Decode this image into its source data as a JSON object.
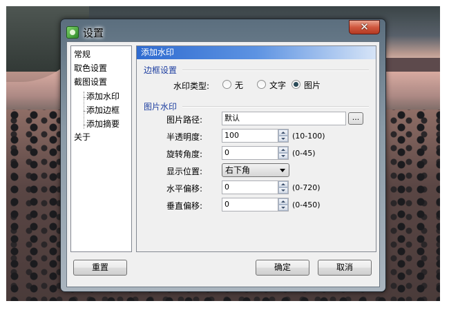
{
  "dialog": {
    "title": "设置",
    "close_glyph": "✕"
  },
  "nav": {
    "items": [
      {
        "label": "常规",
        "level": 0
      },
      {
        "label": "取色设置",
        "level": 0
      },
      {
        "label": "截图设置",
        "level": 0
      },
      {
        "label": "添加水印",
        "level": 1
      },
      {
        "label": "添加边框",
        "level": 1
      },
      {
        "label": "添加摘要",
        "level": 1
      },
      {
        "label": "关于",
        "level": 0
      }
    ]
  },
  "panel": {
    "header": "添加水印",
    "border_section": {
      "title": "边框设置",
      "type_label": "水印类型:",
      "options": [
        {
          "label": "无",
          "selected": false
        },
        {
          "label": "文字",
          "selected": false
        },
        {
          "label": "图片",
          "selected": true
        }
      ]
    },
    "image_section": {
      "title": "图片水印",
      "path_label": "图片路径:",
      "path_value": "默认",
      "browse_label": "...",
      "opacity_label": "半透明度:",
      "opacity_value": "100",
      "opacity_range": "(10-100)",
      "rotation_label": "旋转角度:",
      "rotation_value": "0",
      "rotation_range": "(0-45)",
      "position_label": "显示位置:",
      "position_value": "右下角",
      "hoffset_label": "水平偏移:",
      "hoffset_value": "0",
      "hoffset_range": "(0-720)",
      "voffset_label": "垂直偏移:",
      "voffset_value": "0",
      "voffset_range": "(0-450)"
    }
  },
  "footer": {
    "reset_label": "重置",
    "ok_label": "确定",
    "cancel_label": "取消"
  },
  "icons": {
    "app": "app-icon",
    "close": "close-icon",
    "spin_up": "arrow-up-icon",
    "spin_down": "arrow-down-icon",
    "dropdown": "chevron-down-icon"
  }
}
